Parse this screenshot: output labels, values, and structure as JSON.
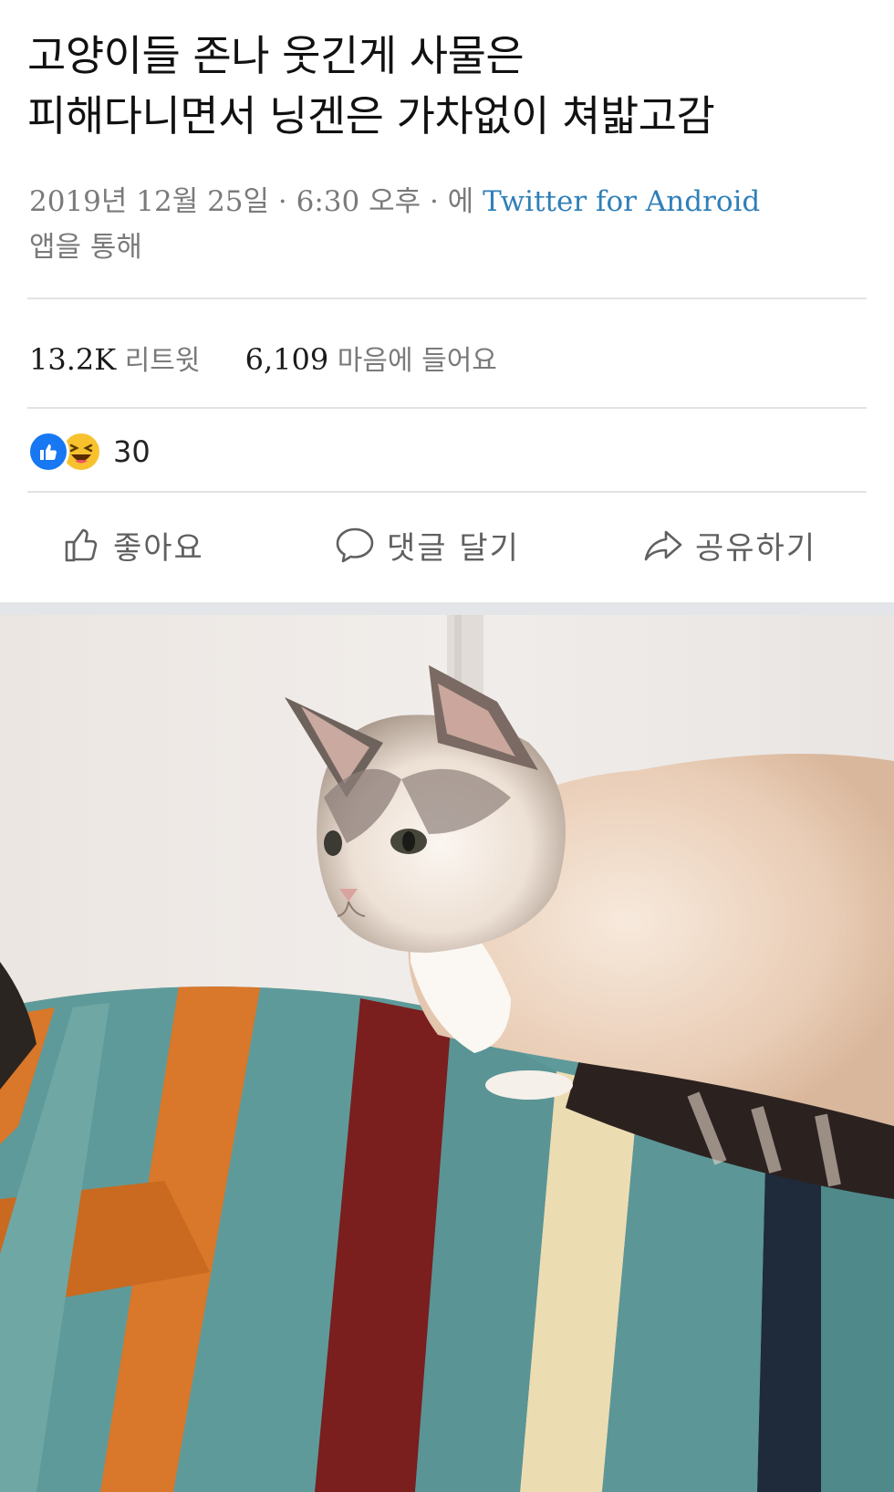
{
  "tweet": {
    "text_line1": "고양이들 존나 웃긴게 사물은",
    "text_line2": "피해다니면서 닝겐은 가차없이 쳐밟고감",
    "timestamp": "2019년 12월 25일 · 6:30 오후 · 에",
    "client": "Twitter for Android",
    "client_suffix": "앱을 통해",
    "retweet_count": "13.2K",
    "retweet_label": "리트윗",
    "like_count": "6,109",
    "like_label": "마음에 들어요"
  },
  "facebook": {
    "reaction_count": "30",
    "reactions": [
      "like-icon",
      "haha-icon"
    ],
    "actions": {
      "like": "좋아요",
      "comment": "댓글 달기",
      "share": "공유하기"
    }
  },
  "colors": {
    "link": "#2f7fb8",
    "fb_blue": "#1877f2",
    "haha_yellow": "#f7c22e"
  }
}
